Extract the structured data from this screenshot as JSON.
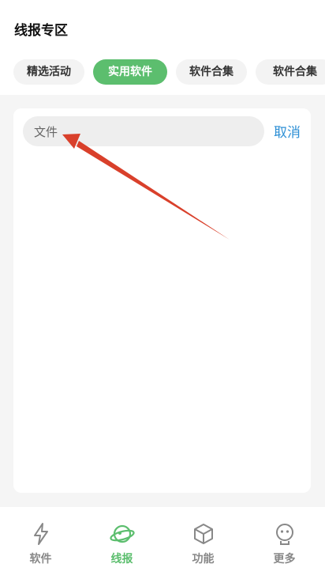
{
  "header": {
    "title": "线报专区"
  },
  "tabs": [
    {
      "label": "精选活动",
      "active": false
    },
    {
      "label": "实用软件",
      "active": true
    },
    {
      "label": "软件合集",
      "active": false
    },
    {
      "label": "软件合集",
      "active": false
    }
  ],
  "search": {
    "value": "文件",
    "placeholder": "",
    "cancel_label": "取消"
  },
  "bottom_nav": [
    {
      "label": "软件",
      "icon": "lightning-icon",
      "active": false
    },
    {
      "label": "线报",
      "icon": "planet-icon",
      "active": true
    },
    {
      "label": "功能",
      "icon": "cube-icon",
      "active": false
    },
    {
      "label": "更多",
      "icon": "robot-icon",
      "active": false
    }
  ],
  "colors": {
    "accent": "#5cbe6e",
    "link": "#2d8fd5",
    "annotation_arrow": "#d9402b"
  }
}
